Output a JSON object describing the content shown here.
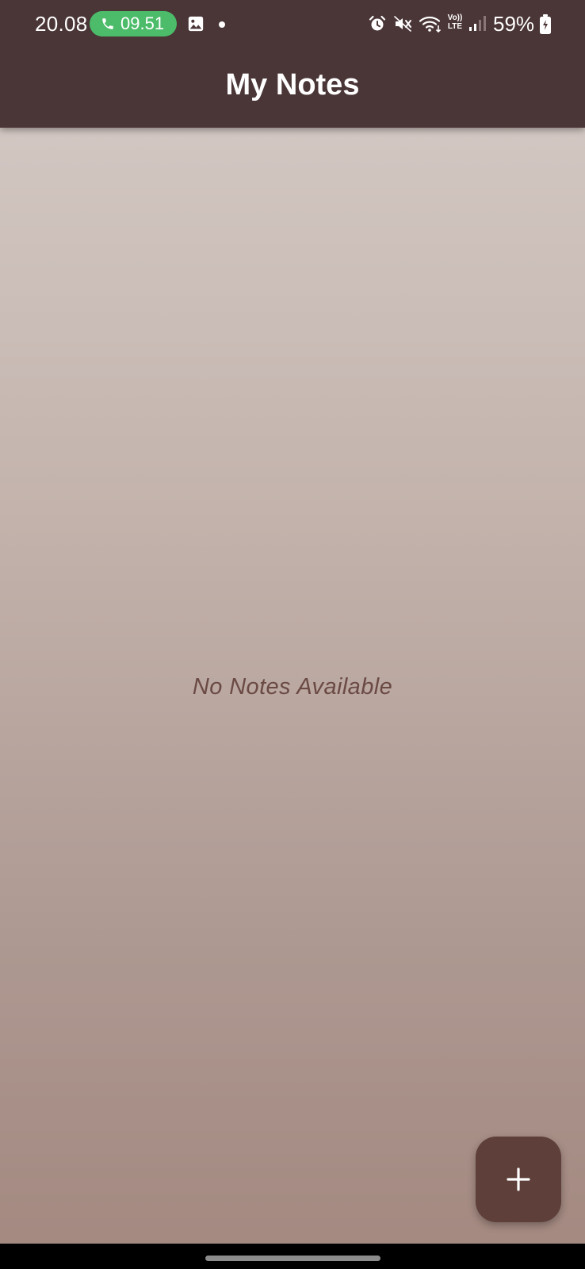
{
  "status_bar": {
    "time": "20.08",
    "call_duration": "09.51",
    "battery": "59%",
    "network": [
      "Vo))",
      "LTE"
    ],
    "icons": [
      "phone-icon",
      "gallery-icon",
      "notification-dot",
      "alarm-icon",
      "mute-icon",
      "wifi-icon",
      "volte-lte-icon",
      "signal-icon",
      "battery-icon"
    ],
    "call_pill_color": "#4cbc6a"
  },
  "app_bar": {
    "title": "My Notes",
    "background_color": "#4b3637"
  },
  "main": {
    "empty_message": "No Notes Available",
    "empty_message_color": "#6b4a44",
    "background_gradient": [
      "#d7cdc9",
      "#a3887f"
    ]
  },
  "fab": {
    "icon": "plus-icon",
    "color": "#5e3f39"
  }
}
